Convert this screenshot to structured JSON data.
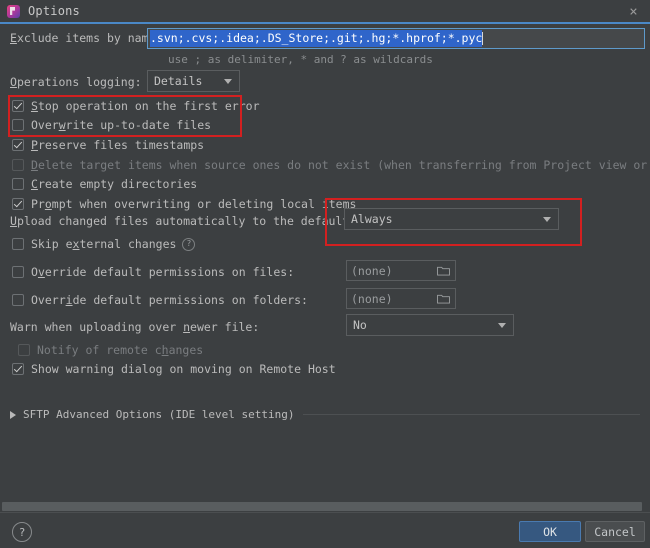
{
  "window": {
    "title": "Options",
    "icon": "pycharm-logo-icon",
    "close_label": "×"
  },
  "exclude": {
    "label_prefix": "E",
    "label": "Exclude items by name:",
    "value": ".svn;.cvs;.idea;.DS_Store;.git;.hg;*.hprof;*.pyc",
    "hint": "use ; as delimiter, * and ? as wildcards"
  },
  "logging": {
    "label": "Operations logging:",
    "value": "Details"
  },
  "checkboxes": [
    {
      "label": "Stop operation on the first error",
      "checked": true,
      "disabled": false
    },
    {
      "label": "Overwrite up-to-date files",
      "checked": false,
      "disabled": false
    },
    {
      "label": "Preserve files timestamps",
      "checked": true,
      "disabled": false
    },
    {
      "label": "Delete target items when source ones do not exist (when transferring from Project view or Remote Host view)",
      "checked": false,
      "disabled": true
    },
    {
      "label": "Create empty directories",
      "checked": false,
      "disabled": false
    },
    {
      "label": "Prompt when overwriting or deleting local items",
      "checked": true,
      "disabled": false
    }
  ],
  "upload": {
    "label": "Upload changed files automatically to the default server",
    "value": "Always"
  },
  "skip_external": {
    "label": "Skip external changes",
    "checked": false,
    "help_glyph": "?"
  },
  "perm_files": {
    "label": "Override default permissions on files:",
    "checked": false,
    "value": "(none)",
    "browse_icon": "folder-icon"
  },
  "perm_folders": {
    "label": "Override default permissions on folders:",
    "checked": false,
    "value": "(none)",
    "browse_icon": "folder-icon"
  },
  "warn_newer": {
    "label": "Warn when uploading over newer file:",
    "value": "No"
  },
  "notify_remote": {
    "label": "Notify of remote changes",
    "checked": false,
    "disabled": true
  },
  "show_warning": {
    "label": "Show warning dialog on moving on Remote Host",
    "checked": true
  },
  "sftp": {
    "label": "SFTP Advanced Options (IDE level setting)",
    "expanded": false
  },
  "footer": {
    "help_glyph": "?",
    "ok_label": "OK",
    "cancel_label": "Cancel"
  },
  "colors": {
    "dialog_bg": "#3c3f41",
    "accent_blue": "#4a88c7",
    "ok_button": "#365880",
    "annotation_red": "#d32020",
    "selection_blue": "#2f65ca"
  }
}
